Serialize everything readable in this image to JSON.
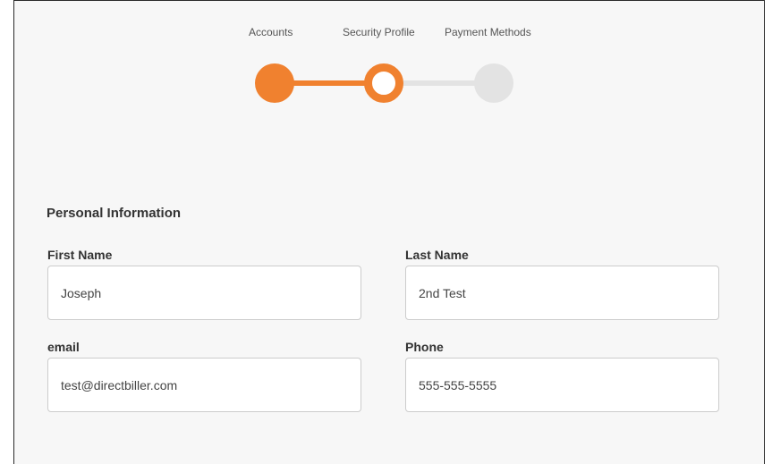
{
  "stepper": {
    "steps": [
      {
        "label": "Accounts",
        "state": "complete"
      },
      {
        "label": "Security Profile",
        "state": "current"
      },
      {
        "label": "Payment Methods",
        "state": "upcoming"
      }
    ]
  },
  "colors": {
    "accent": "#f0812f",
    "inactive": "#e3e3e3",
    "background": "#f7f7f7"
  },
  "form": {
    "section_title": "Personal Information",
    "first_name": {
      "label": "First Name",
      "value": "Joseph"
    },
    "last_name": {
      "label": "Last Name",
      "value": "2nd Test"
    },
    "email": {
      "label": "email",
      "value": "test@directbiller.com"
    },
    "phone": {
      "label": "Phone",
      "value": "555-555-5555"
    }
  }
}
